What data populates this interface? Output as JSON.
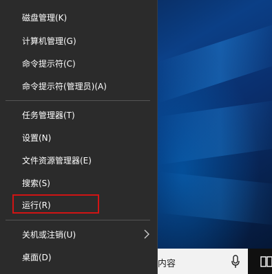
{
  "menu": {
    "items": [
      {
        "label": "磁盘管理(K)"
      },
      {
        "label": "计算机管理(G)"
      },
      {
        "label": "命令提示符(C)"
      },
      {
        "label": "命令提示符(管理员)(A)"
      },
      {
        "label": "任务管理器(T)"
      },
      {
        "label": "设置(N)"
      },
      {
        "label": "文件资源管理器(E)"
      },
      {
        "label": "搜索(S)"
      },
      {
        "label": "运行(R)"
      },
      {
        "label": "关机或注销(U)"
      },
      {
        "label": "桌面(D)"
      }
    ],
    "highlighted_item": "运行(R)",
    "highlight_color": "#d21414",
    "background_color": "#2b2b2b"
  },
  "taskbar": {
    "search_text": "内容",
    "search_icon": "microphone-icon",
    "task_view_icon": "task-view-icon"
  }
}
